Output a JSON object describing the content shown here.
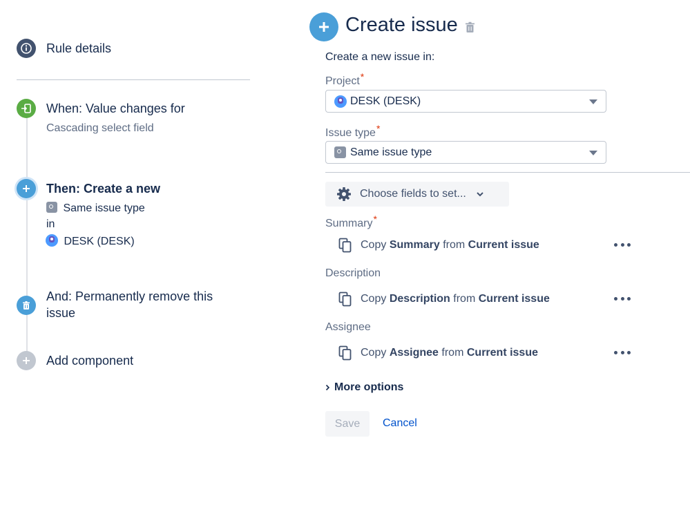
{
  "left_panel": {
    "rule_details": "Rule details",
    "trigger": {
      "title": "When: Value changes for",
      "subtitle": "Cascading select field"
    },
    "action_create": {
      "title": "Then: Create a new",
      "issue_type": "Same issue type",
      "in_text": "in",
      "project": "DESK (DESK)"
    },
    "action_delete": {
      "title_line1": "And: Permanently remove this",
      "title_line2": "issue"
    },
    "add_component": "Add component"
  },
  "right_panel": {
    "title": "Create issue",
    "intro": "Create a new issue in:",
    "project_label": "Project",
    "project_value": "DESK (DESK)",
    "issue_type_label": "Issue type",
    "issue_type_value": "Same issue type",
    "required_mark": "*",
    "choose_fields": "Choose fields to set...",
    "fields": [
      {
        "label": "Summary",
        "required": true,
        "copy": "Copy",
        "field": "Summary",
        "from": "from",
        "source": "Current issue"
      },
      {
        "label": "Description",
        "required": false,
        "copy": "Copy",
        "field": "Description",
        "from": "from",
        "source": "Current issue"
      },
      {
        "label": "Assignee",
        "required": false,
        "copy": "Copy",
        "field": "Assignee",
        "from": "from",
        "source": "Current issue"
      }
    ],
    "more_options": "More options",
    "save": "Save",
    "cancel": "Cancel"
  },
  "colors": {
    "rule_details_icon": "#42526e",
    "trigger_icon": "#5aac44",
    "action_icon": "#4a9fd8",
    "add_icon": "#c1c7d0",
    "required": "#de350b",
    "link": "#0052cc"
  },
  "icons": {
    "rule_details": "info-icon",
    "trigger": "trigger-enter-icon",
    "create": "plus-icon",
    "delete": "trash-icon",
    "add": "plus-icon",
    "title_delete": "trash-icon",
    "choose_fields": "gear-icon",
    "copy": "copy-icon",
    "more": "more-dots-icon"
  }
}
